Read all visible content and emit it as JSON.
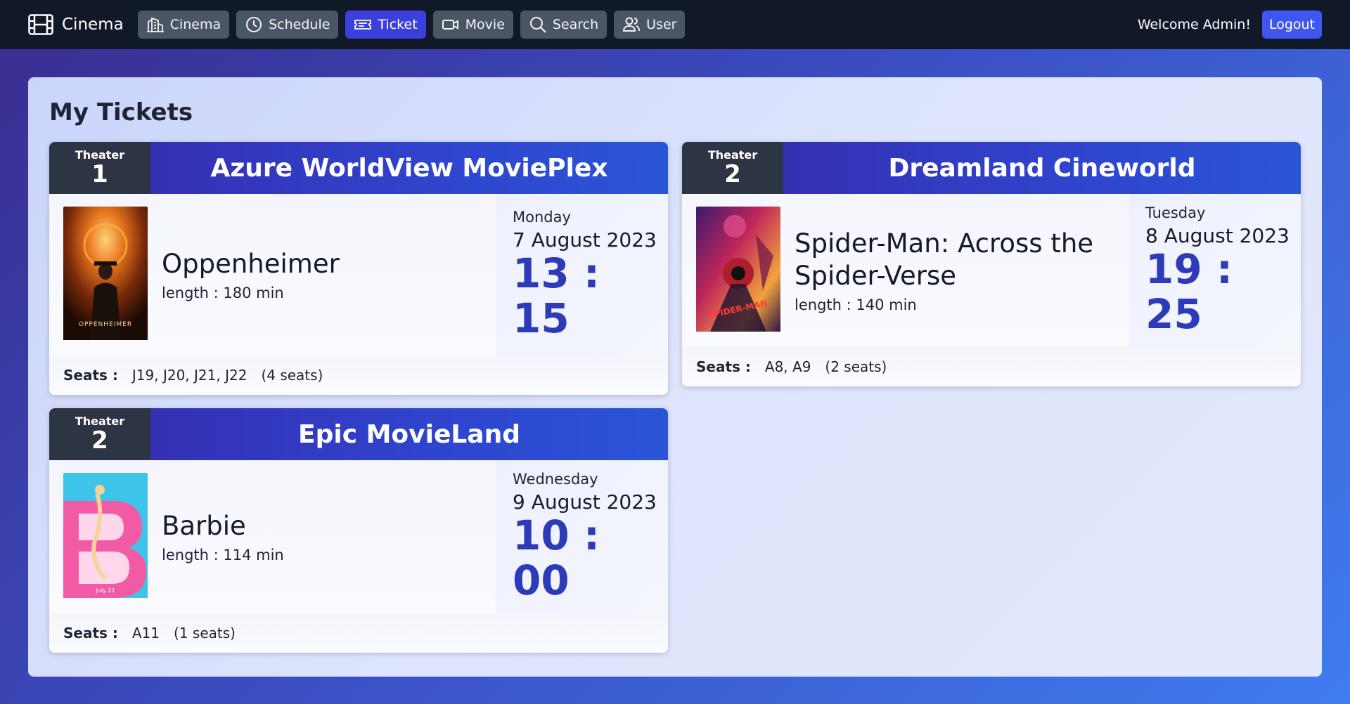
{
  "nav": {
    "brand": "Cinema",
    "items": [
      {
        "label": "Cinema",
        "icon": "building-icon"
      },
      {
        "label": "Schedule",
        "icon": "clock-icon"
      },
      {
        "label": "Ticket",
        "icon": "ticket-icon",
        "active": true
      },
      {
        "label": "Movie",
        "icon": "video-camera-icon"
      },
      {
        "label": "Search",
        "icon": "search-icon"
      },
      {
        "label": "User",
        "icon": "users-icon"
      }
    ],
    "welcome": "Welcome Admin!",
    "logout": "Logout"
  },
  "page": {
    "title": "My Tickets"
  },
  "tickets": [
    {
      "theater_label": "Theater",
      "theater_number": "1",
      "cinema": "Azure WorldView MoviePlex",
      "movie": "Oppenheimer",
      "length": "length : 180 min",
      "day": "Monday",
      "date": "7 August 2023",
      "time": "13 : 15",
      "seats_label": "Seats :",
      "seats": "J19, J20, J21, J22",
      "seat_count": "(4 seats)",
      "poster_caption": "OPPENHEIMER"
    },
    {
      "theater_label": "Theater",
      "theater_number": "2",
      "cinema": "Dreamland Cineworld",
      "movie": "Spider-Man: Across the Spider-Verse",
      "length": "length : 140 min",
      "day": "Tuesday",
      "date": "8 August 2023",
      "time": "19 : 25",
      "seats_label": "Seats :",
      "seats": "A8, A9",
      "seat_count": "(2 seats)",
      "poster_caption": "SPIDER-MAN"
    },
    {
      "theater_label": "Theater",
      "theater_number": "2",
      "cinema": "Epic MovieLand",
      "movie": "Barbie",
      "length": "length : 114 min",
      "day": "Wednesday",
      "date": "9 August 2023",
      "time": "10 : 00",
      "seats_label": "Seats :",
      "seats": "A11",
      "seat_count": "(1 seats)",
      "poster_caption": "July 21"
    }
  ],
  "colors": {
    "navbar": "#111827",
    "active_nav": "#3b3fdc",
    "cinema_header": "#2f46cf",
    "time_text": "#2d3bb8"
  }
}
